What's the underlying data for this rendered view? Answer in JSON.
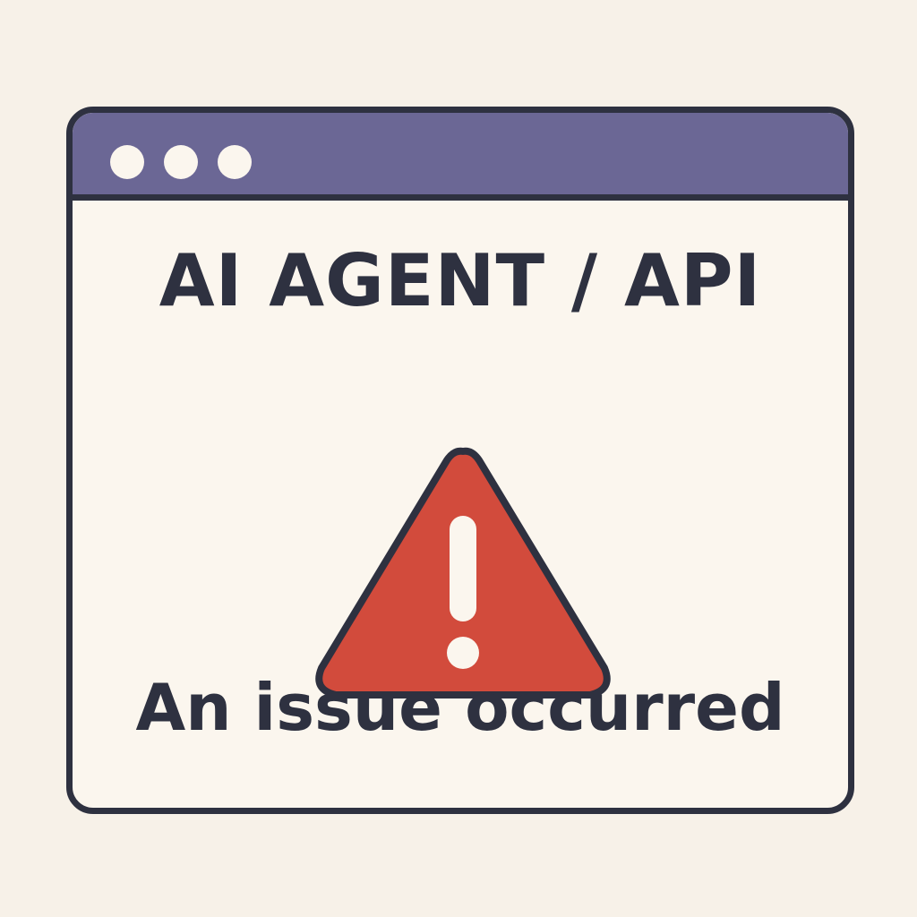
{
  "colors": {
    "page_background": "#f7f1e8",
    "window_background": "#fbf6ee",
    "titlebar": "#6b6795",
    "outline": "#2e3140",
    "text": "#2e3140",
    "warning_fill": "#d24b3c",
    "warning_mark": "#fbf6ee"
  },
  "window": {
    "controls": [
      "window-dot",
      "window-dot",
      "window-dot"
    ],
    "heading": "AI AGENT / API",
    "icon": "warning-icon",
    "message": "An issue occurred"
  }
}
